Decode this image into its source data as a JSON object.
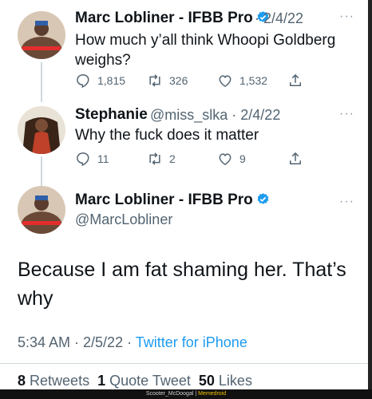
{
  "tweet1": {
    "name": "Marc Lobliner - IFBB Pro",
    "meta": "· 2/4/22",
    "text_line1": "How much y’all think Whoopi Goldberg",
    "text_line2": "weighs?",
    "replies": "1,815",
    "retweets": "326",
    "likes": "1,532"
  },
  "tweet2": {
    "name": "Stephanie",
    "handle_date": "@miss_slka · 2/4/22",
    "text": "Why the fuck does it matter",
    "replies": "11",
    "retweets": "2",
    "likes": "9"
  },
  "main": {
    "name": "Marc Lobliner - IFBB Pro",
    "handle": "@MarcLobliner",
    "text_line1": "Because I am fat shaming her. That’s",
    "text_line2": "why",
    "time": "5:34 AM · 2/5/22 · ",
    "client": "Twitter for iPhone",
    "retweets_count": "8",
    "retweets_label": "Retweets",
    "quotes_count": "1",
    "quotes_label": "Quote Tweet",
    "likes_count": "50",
    "likes_label": "Likes"
  },
  "watermark": {
    "left": "Scooter_McDoogal | ",
    "right": "Memedroid"
  },
  "more_glyph": "···",
  "colors": {
    "accent": "#1d9bf0",
    "secondary_text": "#536471",
    "primary_text": "#0f1419",
    "divider": "#cfd9de"
  },
  "icons": [
    "reply-icon",
    "retweet-icon",
    "like-icon",
    "share-icon",
    "verified-badge-icon",
    "more-icon"
  ]
}
